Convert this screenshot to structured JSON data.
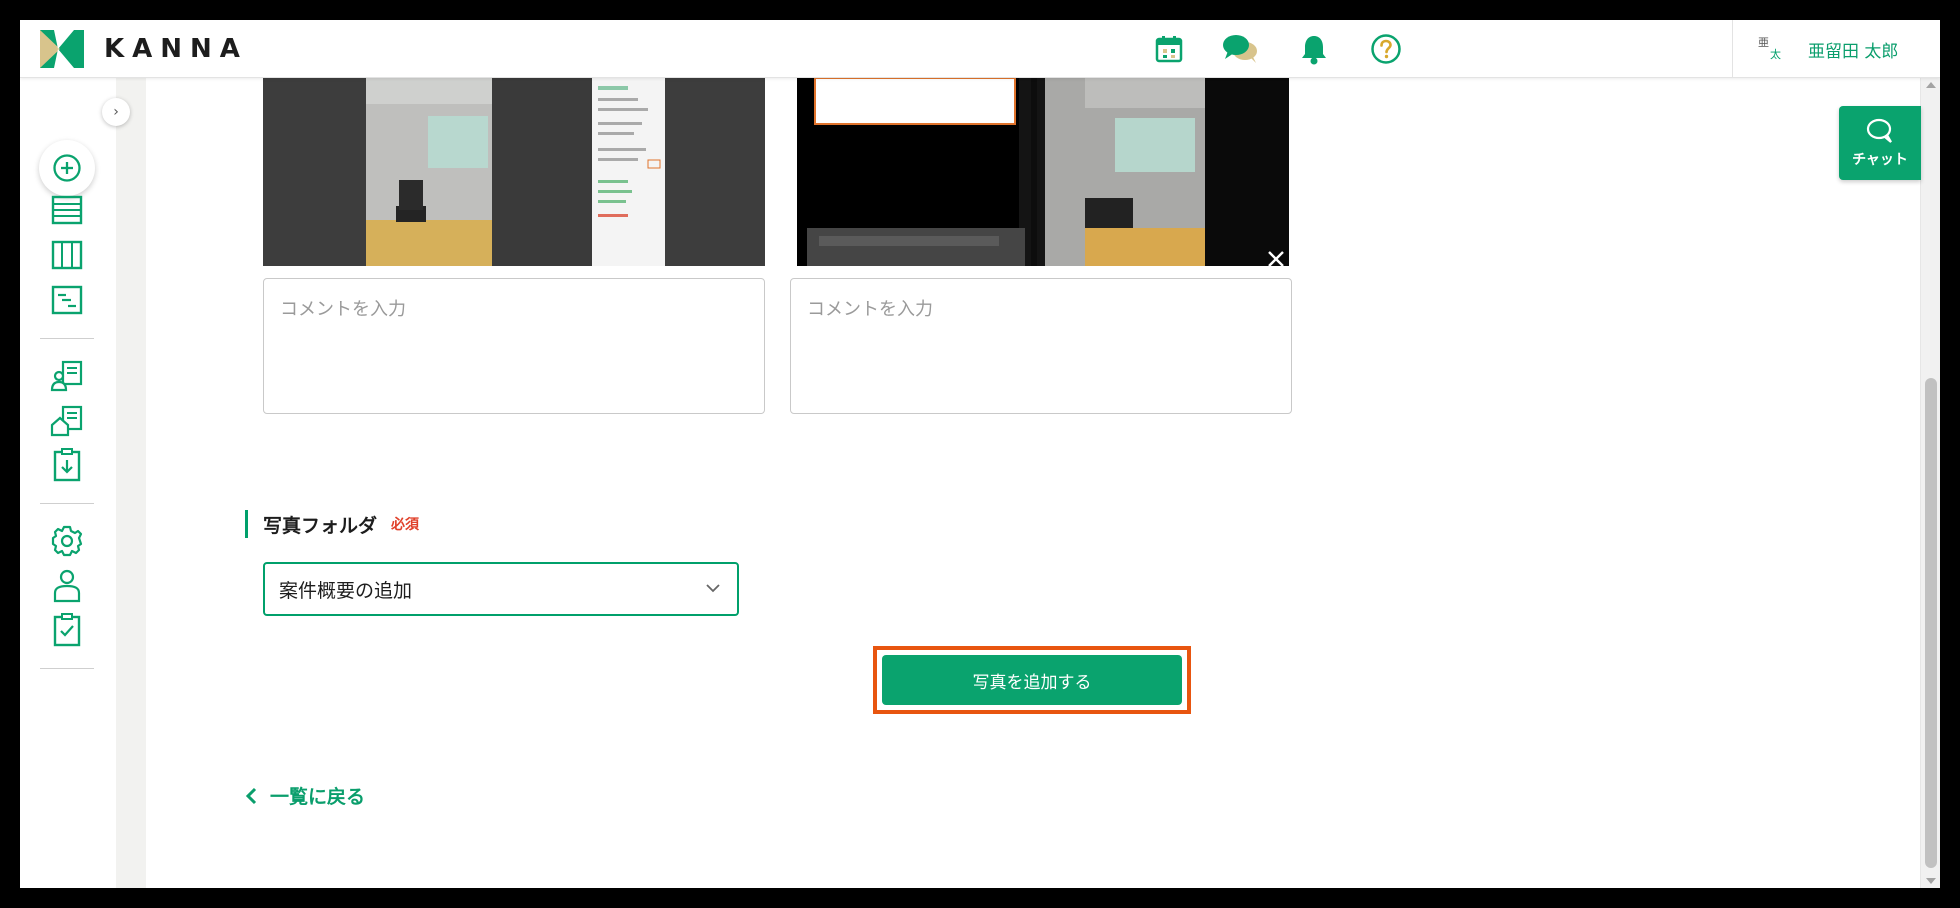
{
  "app": {
    "logo_text": "KANNA"
  },
  "header": {
    "icons": [
      "calendar-icon",
      "chat-bubbles-icon",
      "bell-icon",
      "help-icon"
    ],
    "user": {
      "avatar_char_1": "亜",
      "avatar_char_2": "太",
      "name": "亜留田 太郎"
    }
  },
  "sidebar": {
    "collapse_label": "›",
    "items": [
      "list-icon",
      "columns-icon",
      "gantt-icon",
      "client-icon",
      "property-icon",
      "download-icon",
      "gear-icon",
      "person-icon",
      "clipboard-check-icon"
    ]
  },
  "photos": {
    "comment_placeholder_1": "コメントを入力",
    "comment_placeholder_2": "コメントを入力",
    "remove_label": "×"
  },
  "folder": {
    "title": "写真フォルダ",
    "required_label": "必須",
    "selected_value": "案件概要の追加"
  },
  "actions": {
    "add_photo_label": "写真を追加する",
    "back_label": "一覧に戻る"
  },
  "chat_tab": {
    "label": "チャット"
  },
  "colors": {
    "brand_green": "#0aa36e",
    "highlight_orange": "#e8550f",
    "required_red": "#e0412b"
  }
}
